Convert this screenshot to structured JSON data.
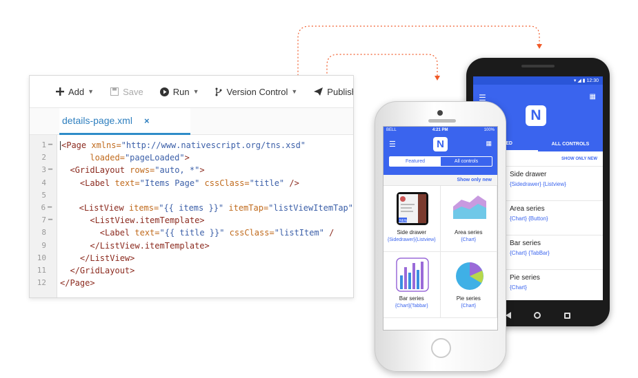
{
  "toolbar": {
    "add": "Add",
    "save": "Save",
    "run": "Run",
    "version_control": "Version Control",
    "publish": "Publish"
  },
  "tab": {
    "label": "details-page.xml",
    "close": "×"
  },
  "code_lines": [
    {
      "num": "1",
      "fold": true
    },
    {
      "num": "2",
      "fold": false
    },
    {
      "num": "3",
      "fold": true
    },
    {
      "num": "4",
      "fold": false
    },
    {
      "num": "5",
      "fold": false
    },
    {
      "num": "6",
      "fold": true
    },
    {
      "num": "7",
      "fold": true
    },
    {
      "num": "8",
      "fold": false
    },
    {
      "num": "9",
      "fold": false
    },
    {
      "num": "10",
      "fold": false
    },
    {
      "num": "11",
      "fold": false
    },
    {
      "num": "12",
      "fold": false
    }
  ],
  "code": {
    "l1_tag": "<Page",
    "l1_attr": " xmlns=",
    "l1_str": "\"http://www.nativescript.org/tns.xsd\"",
    "l2_attr": "loaded=",
    "l2_str": "\"pageLoaded\"",
    "l2_tag": ">",
    "l3_tag": "<GridLayout",
    "l3_attr": " rows=",
    "l3_str": "\"auto, *\"",
    "l3_end": ">",
    "l4_tag": "<Label",
    "l4_attr1": " text=",
    "l4_str1": "\"Items Page\"",
    "l4_attr2": " cssClass=",
    "l4_str2": "\"title\"",
    "l4_end": " />",
    "l6_tag": "<ListView",
    "l6_attr1": " items=",
    "l6_str1": "\"{{ items }}\"",
    "l6_attr2": " itemTap=",
    "l6_str2": "\"listViewItemTap\"",
    "l7_tag": "<ListView.itemTemplate>",
    "l8_tag": "<Label",
    "l8_attr1": " text=",
    "l8_str1": "\"{{ title }}\"",
    "l8_attr2": " cssClass=",
    "l8_str2": "\"listItem\"",
    "l8_end": " /",
    "l9_tag": "</ListView.itemTemplate>",
    "l10_tag": "</ListView>",
    "l11_tag": "</GridLayout>",
    "l12_tag": "</Page>"
  },
  "iphone": {
    "carrier": "BELL",
    "time": "4:21 PM",
    "battery": "100%",
    "logo": "N",
    "seg_featured": "Featured",
    "seg_all": "All controls",
    "show_only_new": "Show only new",
    "cells": [
      {
        "name": "Side drawer",
        "tags": "{Sidedrawer}{Listview}"
      },
      {
        "name": "Area series",
        "tags": "{Chart}"
      },
      {
        "name": "Bar series",
        "tags": "{Chart}{Tabbar}"
      },
      {
        "name": "Pie series",
        "tags": "{Chart}"
      }
    ],
    "thumb_badge": "NEW"
  },
  "android": {
    "time": "12:30",
    "logo": "N",
    "tab_featured": "URED",
    "tab_all": "ALL CONTROLS",
    "show_only_new": "SHOW ONLY NEW",
    "rows": [
      {
        "name": "Side drawer",
        "tags": "{Sidedrawer} {Listview}"
      },
      {
        "name": "Area series",
        "tags": "{Chart} {Button}"
      },
      {
        "name": "Bar series",
        "tags": "{Chart} {TabBar}"
      },
      {
        "name": "Pie series",
        "tags": "{Chart}"
      }
    ]
  },
  "colors": {
    "accent": "#3a64ee",
    "connector": "#f05a28",
    "tab_underline": "#2e8cc8"
  },
  "icons": [
    "plus-icon",
    "save-icon",
    "play-icon",
    "branch-icon",
    "paper-plane-icon",
    "close-icon",
    "hamburger-icon",
    "grid-icon"
  ]
}
